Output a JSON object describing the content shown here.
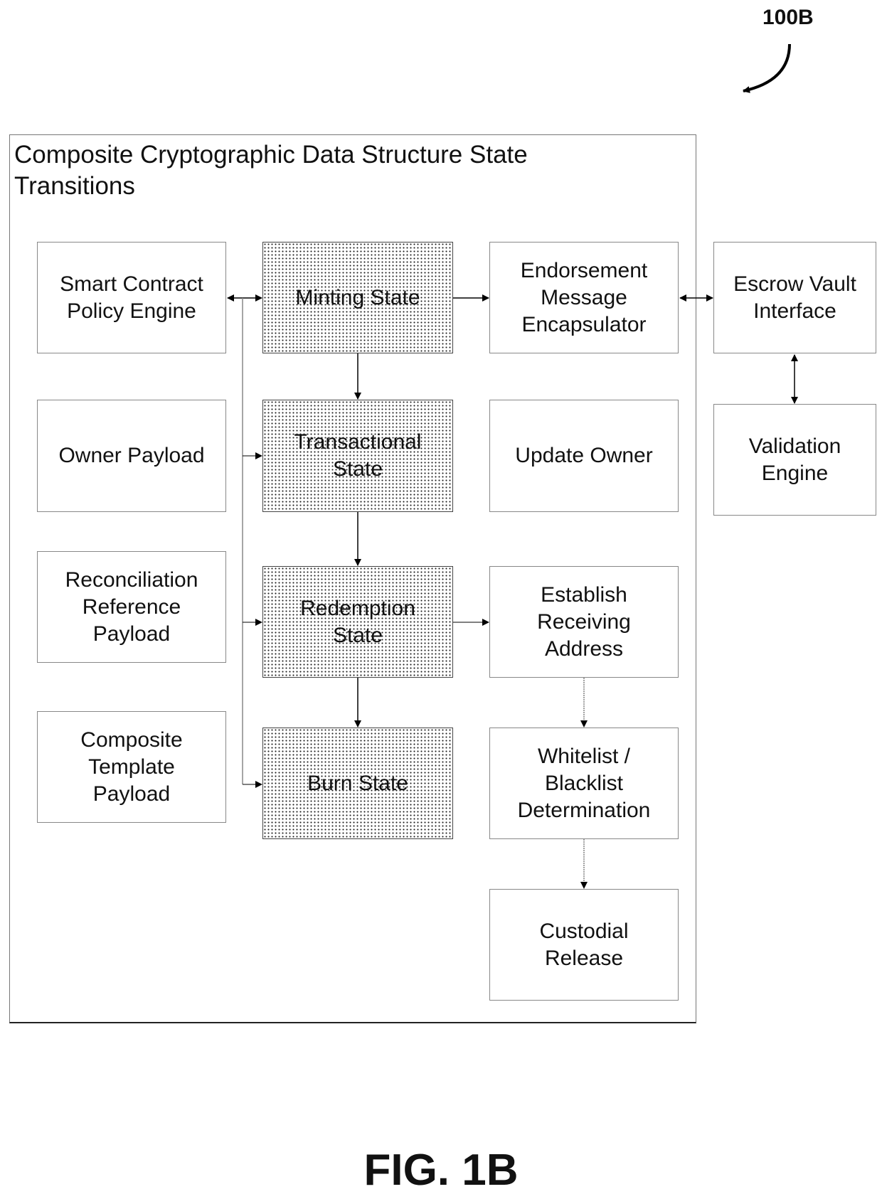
{
  "reference_numeral": "100B",
  "figure_label": "FIG. 1B",
  "container": {
    "title": "Composite Cryptographic Data Structure  State Transitions"
  },
  "payloads": [
    {
      "id": "smart-contract-policy-engine",
      "label": "Smart Contract\nPolicy Engine"
    },
    {
      "id": "owner-payload",
      "label": "Owner Payload"
    },
    {
      "id": "reconciliation-reference-payload",
      "label": "Reconciliation\nReference\nPayload"
    },
    {
      "id": "composite-template-payload",
      "label": "Composite\nTemplate\nPayload"
    }
  ],
  "states": [
    {
      "id": "minting-state",
      "label": "Minting State"
    },
    {
      "id": "transactional-state",
      "label": "Transactional\nState"
    },
    {
      "id": "redemption-state",
      "label": "Redemption\nState"
    },
    {
      "id": "burn-state",
      "label": "Burn State"
    }
  ],
  "actions": [
    {
      "id": "endorsement-message-encapsulator",
      "label": "Endorsement\nMessage\nEncapsulator"
    },
    {
      "id": "update-owner",
      "label": "Update Owner"
    },
    {
      "id": "establish-receiving-address",
      "label": "Establish\nReceiving\nAddress"
    },
    {
      "id": "whitelist-blacklist-determination",
      "label": "Whitelist /\nBlacklist\nDetermination"
    },
    {
      "id": "custodial-release",
      "label": "Custodial\nRelease"
    }
  ],
  "external": [
    {
      "id": "escrow-vault-interface",
      "label": "Escrow Vault\nInterface"
    },
    {
      "id": "validation-engine",
      "label": "Validation\nEngine"
    }
  ],
  "connections": [
    {
      "from": "smart-contract-policy-engine",
      "to": "minting-state",
      "type": "bidirectional"
    },
    {
      "from": "policy-bus",
      "to": "transactional-state",
      "type": "arrow"
    },
    {
      "from": "policy-bus",
      "to": "redemption-state",
      "type": "arrow"
    },
    {
      "from": "policy-bus",
      "to": "burn-state",
      "type": "arrow"
    },
    {
      "from": "minting-state",
      "to": "endorsement-message-encapsulator",
      "type": "arrow"
    },
    {
      "from": "endorsement-message-encapsulator",
      "to": "escrow-vault-interface",
      "type": "bidirectional"
    },
    {
      "from": "escrow-vault-interface",
      "to": "validation-engine",
      "type": "bidirectional"
    },
    {
      "from": "minting-state",
      "to": "transactional-state",
      "type": "arrow"
    },
    {
      "from": "transactional-state",
      "to": "redemption-state",
      "type": "arrow"
    },
    {
      "from": "redemption-state",
      "to": "burn-state",
      "type": "arrow"
    },
    {
      "from": "redemption-state",
      "to": "establish-receiving-address",
      "type": "arrow"
    },
    {
      "from": "establish-receiving-address",
      "to": "whitelist-blacklist-determination",
      "type": "arrow"
    },
    {
      "from": "whitelist-blacklist-determination",
      "to": "custodial-release",
      "type": "arrow"
    }
  ]
}
